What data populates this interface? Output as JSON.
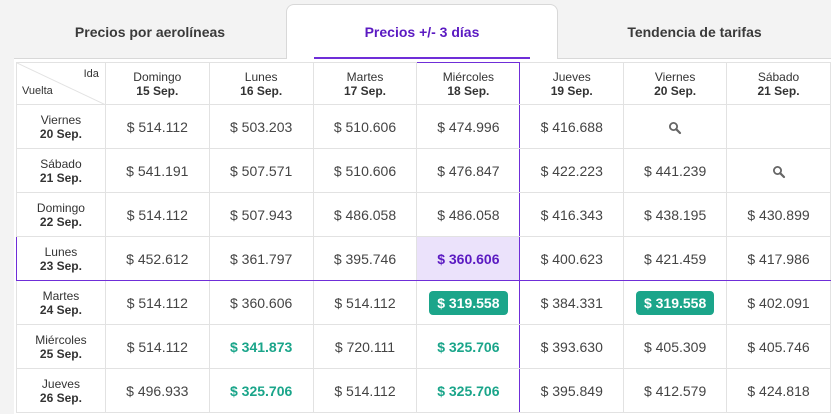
{
  "tabs": [
    {
      "label": "Precios por aerolíneas"
    },
    {
      "label": "Precios +/- 3 días"
    },
    {
      "label": "Tendencia de tarifas"
    }
  ],
  "corner": {
    "ida": "Ida",
    "vuelta": "Vuelta"
  },
  "columns": [
    {
      "day": "Domingo",
      "date": "15 Sep."
    },
    {
      "day": "Lunes",
      "date": "16 Sep."
    },
    {
      "day": "Martes",
      "date": "17 Sep."
    },
    {
      "day": "Miércoles",
      "date": "18 Sep."
    },
    {
      "day": "Jueves",
      "date": "19 Sep."
    },
    {
      "day": "Viernes",
      "date": "20 Sep."
    },
    {
      "day": "Sábado",
      "date": "21 Sep."
    }
  ],
  "rows": [
    {
      "day": "Viernes",
      "date": "20 Sep.",
      "cells": [
        {
          "v": "$ 514.112"
        },
        {
          "v": "$ 503.203"
        },
        {
          "v": "$ 510.606"
        },
        {
          "v": "$ 474.996"
        },
        {
          "v": "$ 416.688"
        },
        {
          "icon": "search-icon"
        },
        {
          "v": ""
        }
      ]
    },
    {
      "day": "Sábado",
      "date": "21 Sep.",
      "cells": [
        {
          "v": "$ 541.191"
        },
        {
          "v": "$ 507.571"
        },
        {
          "v": "$ 510.606"
        },
        {
          "v": "$ 476.847"
        },
        {
          "v": "$ 422.223"
        },
        {
          "v": "$ 441.239"
        },
        {
          "icon": "search-icon"
        }
      ]
    },
    {
      "day": "Domingo",
      "date": "22 Sep.",
      "cells": [
        {
          "v": "$ 514.112"
        },
        {
          "v": "$ 507.943"
        },
        {
          "v": "$ 486.058"
        },
        {
          "v": "$ 486.058"
        },
        {
          "v": "$ 416.343"
        },
        {
          "v": "$ 438.195"
        },
        {
          "v": "$ 430.899"
        }
      ]
    },
    {
      "day": "Lunes",
      "date": "23 Sep.",
      "cells": [
        {
          "v": "$ 452.612"
        },
        {
          "v": "$ 361.797"
        },
        {
          "v": "$ 395.746"
        },
        {
          "v": "$ 360.606",
          "style": "selected"
        },
        {
          "v": "$ 400.623"
        },
        {
          "v": "$ 421.459"
        },
        {
          "v": "$ 417.986"
        }
      ]
    },
    {
      "day": "Martes",
      "date": "24 Sep.",
      "cells": [
        {
          "v": "$ 514.112"
        },
        {
          "v": "$ 360.606"
        },
        {
          "v": "$ 514.112"
        },
        {
          "v": "$ 319.558",
          "style": "pill"
        },
        {
          "v": "$ 384.331"
        },
        {
          "v": "$ 319.558",
          "style": "pill"
        },
        {
          "v": "$ 402.091"
        }
      ]
    },
    {
      "day": "Miércoles",
      "date": "25 Sep.",
      "cells": [
        {
          "v": "$ 514.112"
        },
        {
          "v": "$ 341.873",
          "style": "green"
        },
        {
          "v": "$ 720.111"
        },
        {
          "v": "$ 325.706",
          "style": "green"
        },
        {
          "v": "$ 393.630"
        },
        {
          "v": "$ 405.309"
        },
        {
          "v": "$ 405.746"
        }
      ]
    },
    {
      "day": "Jueves",
      "date": "26 Sep.",
      "cells": [
        {
          "v": "$ 496.933"
        },
        {
          "v": "$ 325.706",
          "style": "green"
        },
        {
          "v": "$ 514.112"
        },
        {
          "v": "$ 325.706",
          "style": "green"
        },
        {
          "v": "$ 395.849"
        },
        {
          "v": "$ 412.579"
        },
        {
          "v": "$ 424.818"
        }
      ]
    }
  ],
  "colors": {
    "accent": "#6f2ed8",
    "accent_text": "#5b1ac2",
    "selected_bg": "#ebe2fb",
    "green": "#1ba58a"
  }
}
